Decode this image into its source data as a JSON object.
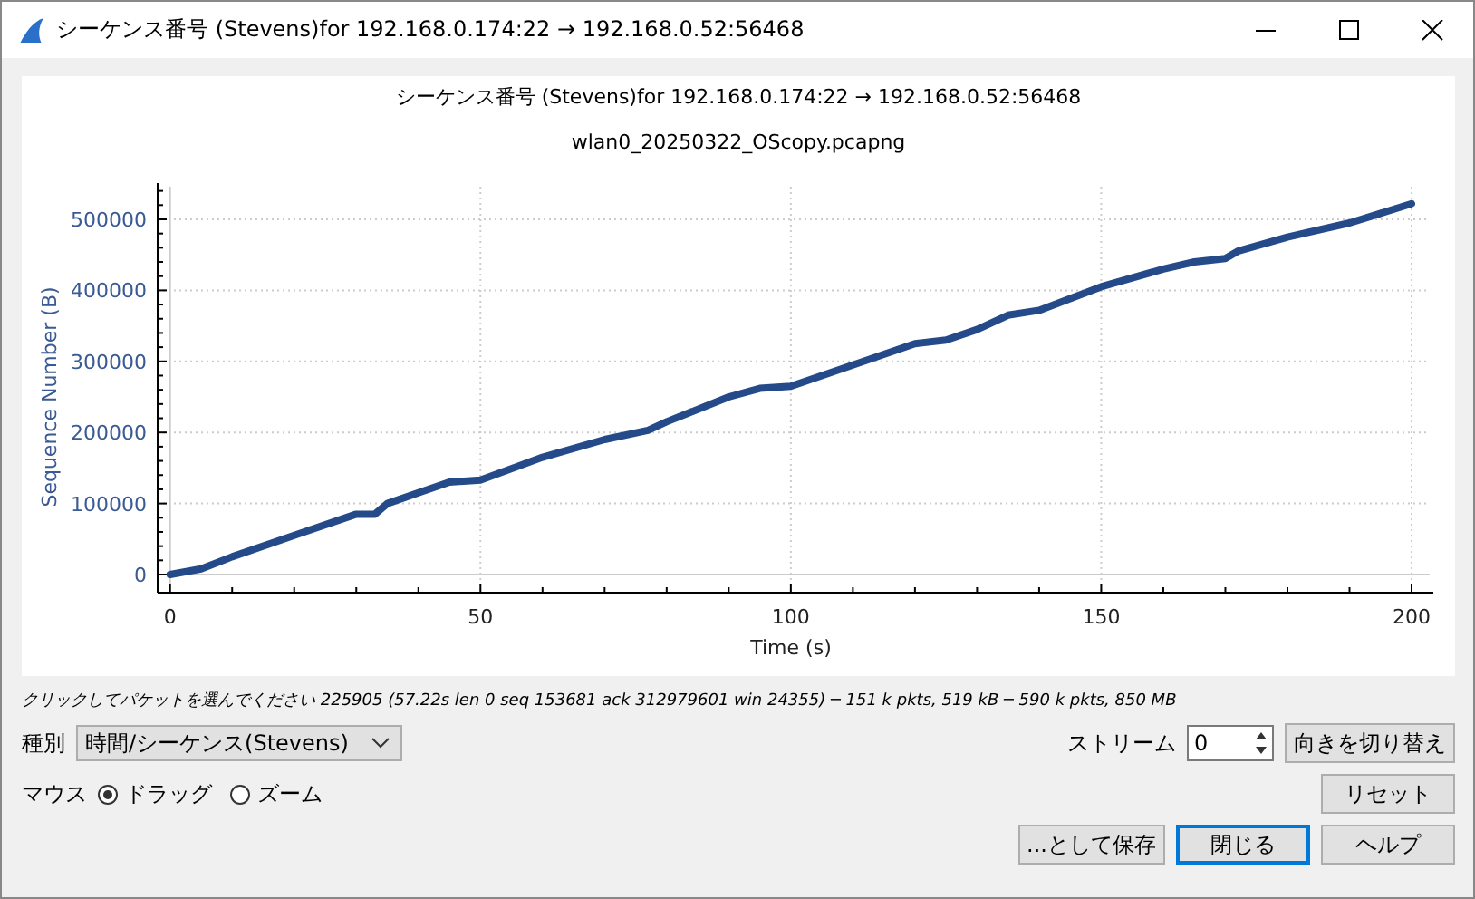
{
  "window": {
    "title": "シーケンス番号 (Stevens)for 192.168.0.174:22 → 192.168.0.52:56468"
  },
  "plot": {
    "title": "シーケンス番号 (Stevens)for 192.168.0.174:22 → 192.168.0.52:56468",
    "subtitle": "wlan0_20250322_OScopy.pcapng",
    "chart_data": {
      "type": "line",
      "xlabel": "Time (s)",
      "ylabel": "Sequence Number (B)",
      "grid": true,
      "xlim": [
        -2,
        203.5
      ],
      "ylim": [
        -25500,
        551000
      ],
      "xticks": [
        0,
        50,
        100,
        150,
        200
      ],
      "yticks": [
        0,
        100000,
        200000,
        300000,
        400000,
        500000
      ],
      "x": [
        0,
        5,
        10,
        20,
        30,
        33,
        35,
        40,
        45,
        50,
        60,
        70,
        77,
        80,
        90,
        95,
        100,
        110,
        120,
        125,
        130,
        135,
        140,
        150,
        160,
        165,
        170,
        172,
        180,
        190,
        200
      ],
      "series": [
        {
          "color": "#244a8a",
          "values": [
            0,
            8000,
            25000,
            55000,
            85000,
            85000,
            100000,
            115000,
            130000,
            133000,
            165000,
            190000,
            203000,
            215000,
            250000,
            262000,
            265000,
            295000,
            325000,
            330000,
            345000,
            365000,
            372000,
            405000,
            430000,
            440000,
            445000,
            455000,
            475000,
            495000,
            522000
          ]
        }
      ]
    }
  },
  "status": "クリックしてパケットを選んでください 225905 (57.22s len 0 seq 153681 ack 312979601 win 24355) ─ 151 k pkts, 519 kB ─ 590 k pkts, 850 MB",
  "type_label": "種別",
  "type_value": "時間/シーケンス(Stevens)",
  "stream_label": "ストリーム",
  "stream_value": "0",
  "swap_button": "向きを切り替え",
  "mouse_label": "マウス",
  "mouse_modes": [
    {
      "label": "ドラッグ",
      "selected": true
    },
    {
      "label": "ズーム",
      "selected": false
    }
  ],
  "reset_button": "リセット",
  "buttons": [
    {
      "label": "...として保存",
      "default": false
    },
    {
      "label": "閉じる",
      "default": true
    },
    {
      "label": "ヘルプ",
      "default": false
    }
  ]
}
